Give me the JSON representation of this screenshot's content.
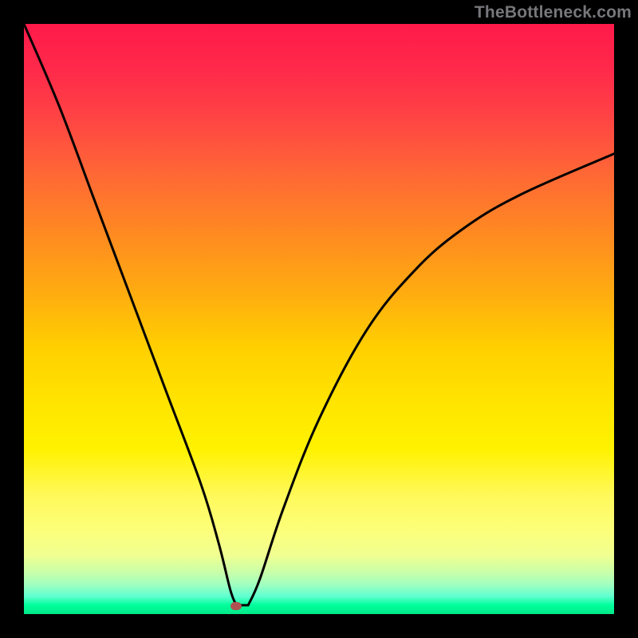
{
  "watermark": "TheBottleneck.com",
  "chart_data": {
    "type": "line",
    "title": "",
    "xlabel": "",
    "ylabel": "",
    "xlim": [
      0,
      100
    ],
    "ylim": [
      0,
      100
    ],
    "curve": {
      "left_branch": [
        {
          "x": 0,
          "y": 100
        },
        {
          "x": 6,
          "y": 86
        },
        {
          "x": 12,
          "y": 70
        },
        {
          "x": 18,
          "y": 54
        },
        {
          "x": 24,
          "y": 38
        },
        {
          "x": 30,
          "y": 22
        },
        {
          "x": 33,
          "y": 12
        },
        {
          "x": 35,
          "y": 4
        },
        {
          "x": 36,
          "y": 1.5
        }
      ],
      "right_branch": [
        {
          "x": 38,
          "y": 1.5
        },
        {
          "x": 40,
          "y": 6
        },
        {
          "x": 44,
          "y": 18
        },
        {
          "x": 50,
          "y": 33
        },
        {
          "x": 58,
          "y": 48
        },
        {
          "x": 66,
          "y": 58
        },
        {
          "x": 74,
          "y": 65
        },
        {
          "x": 84,
          "y": 71
        },
        {
          "x": 100,
          "y": 78
        }
      ]
    },
    "marker": {
      "x": 36,
      "y": 1.3,
      "color": "#b05050"
    },
    "gradient_stops": [
      {
        "pos": 0,
        "color": "#ff1a4a"
      },
      {
        "pos": 50,
        "color": "#ffd000"
      },
      {
        "pos": 100,
        "color": "#00e888"
      }
    ]
  }
}
